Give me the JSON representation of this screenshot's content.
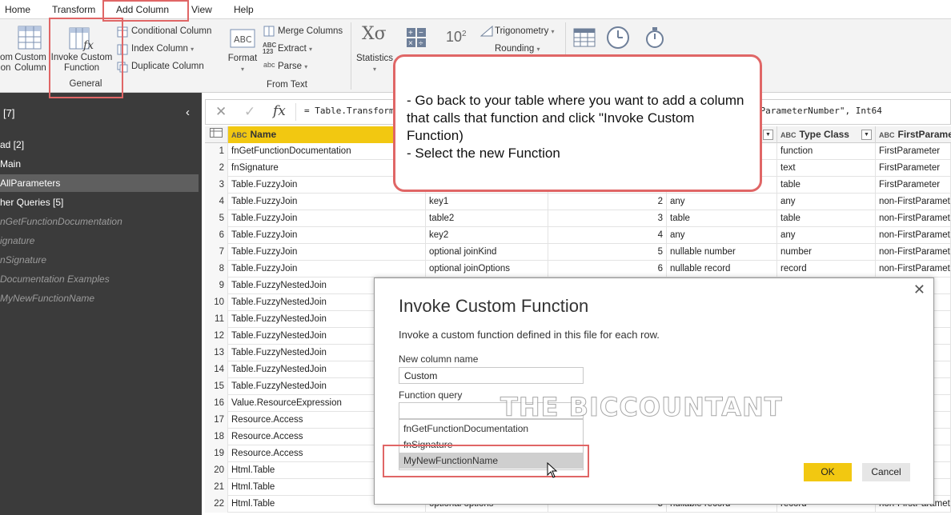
{
  "menu": {
    "items": [
      "Home",
      "Transform",
      "Add Column",
      "View",
      "Help"
    ]
  },
  "ribbon": {
    "custom_column": "Custom\nColumn",
    "custom_column_l1": "Custom",
    "custom_column_l2": "Column",
    "partial_left_l1": "om",
    "partial_left_l2": "on",
    "invoke_l1": "Invoke Custom",
    "invoke_l2": "Function",
    "group_general": "General",
    "conditional_column": "Conditional Column",
    "index_column": "Index Column",
    "duplicate_column": "Duplicate Column",
    "format": "Format",
    "merge_columns": "Merge Columns",
    "extract": "Extract",
    "parse": "Parse",
    "group_from_text": "From Text",
    "statistics": "Statistics",
    "trigonometry": "Trigonometry",
    "rounding": "Rounding",
    "ten_power": "10",
    "abc123": "ABC\n123"
  },
  "sidebar": {
    "header": "[7]",
    "items": [
      {
        "label": "ad [2]",
        "style": "normal"
      },
      {
        "label": "Main",
        "style": "normal"
      },
      {
        "label": "AllParameters",
        "style": "selected"
      },
      {
        "label": "her Queries [5]",
        "style": "normal"
      },
      {
        "label": "nGetFunctionDocumentation",
        "style": "italic"
      },
      {
        "label": "ignature",
        "style": "italic"
      },
      {
        "label": "nSignature",
        "style": "italic"
      },
      {
        "label": "Documentation Examples",
        "style": "italic"
      },
      {
        "label": "MyNewFunctionName",
        "style": "italic"
      }
    ]
  },
  "formula_bar": {
    "cancel_glyph": "✕",
    "commit_glyph": "✓",
    "fx": "fx",
    "formula": "= Table.TransformColumnTypes(Source,{{\"Name\", type text}, {\"Parameter\", type text}, {\"ParameterNumber\", Int64"
  },
  "grid": {
    "headers": [
      {
        "type": "ABC",
        "label": "Name"
      },
      {
        "type": "",
        "label": ""
      },
      {
        "type": "",
        "label": ""
      },
      {
        "type": "",
        "label": ""
      },
      {
        "type": "ABC",
        "label": "Type Class"
      },
      {
        "type": "ABC",
        "label": "FirstParameter"
      }
    ],
    "rows": [
      [
        "1",
        "fnGetFunctionDocumentation",
        "",
        "",
        "",
        "function",
        "FirstParameter"
      ],
      [
        "2",
        "fnSignature",
        "",
        "",
        "",
        "text",
        "FirstParameter"
      ],
      [
        "3",
        "Table.FuzzyJoin",
        "",
        "",
        "",
        "table",
        "FirstParameter"
      ],
      [
        "4",
        "Table.FuzzyJoin",
        "key1",
        "2",
        "any",
        "any",
        "non-FirstParamete"
      ],
      [
        "5",
        "Table.FuzzyJoin",
        "table2",
        "3",
        "table",
        "table",
        "non-FirstParamete"
      ],
      [
        "6",
        "Table.FuzzyJoin",
        "key2",
        "4",
        "any",
        "any",
        "non-FirstParamete"
      ],
      [
        "7",
        "Table.FuzzyJoin",
        "optional joinKind",
        "5",
        "nullable number",
        "number",
        "non-FirstParamete"
      ],
      [
        "8",
        "Table.FuzzyJoin",
        "optional joinOptions",
        "6",
        "nullable record",
        "record",
        "non-FirstParamete"
      ],
      [
        "9",
        "Table.FuzzyNestedJoin",
        "",
        "",
        "",
        "",
        ""
      ],
      [
        "10",
        "Table.FuzzyNestedJoin",
        "",
        "",
        "",
        "",
        ""
      ],
      [
        "11",
        "Table.FuzzyNestedJoin",
        "",
        "",
        "",
        "",
        ""
      ],
      [
        "12",
        "Table.FuzzyNestedJoin",
        "",
        "",
        "",
        "",
        ""
      ],
      [
        "13",
        "Table.FuzzyNestedJoin",
        "",
        "",
        "",
        "",
        ""
      ],
      [
        "14",
        "Table.FuzzyNestedJoin",
        "",
        "",
        "",
        "",
        ""
      ],
      [
        "15",
        "Table.FuzzyNestedJoin",
        "",
        "",
        "",
        "",
        ""
      ],
      [
        "16",
        "Value.ResourceExpression",
        "",
        "",
        "",
        "",
        ""
      ],
      [
        "17",
        "Resource.Access",
        "",
        "",
        "",
        "",
        ""
      ],
      [
        "18",
        "Resource.Access",
        "",
        "",
        "",
        "",
        ""
      ],
      [
        "19",
        "Resource.Access",
        "",
        "",
        "",
        "",
        ""
      ],
      [
        "20",
        "Html.Table",
        "",
        "",
        "",
        "",
        ""
      ],
      [
        "21",
        "Html.Table",
        "",
        "",
        "",
        "",
        ""
      ],
      [
        "22",
        "Html.Table",
        "optional options",
        "5",
        "nullable record",
        "record",
        "non-FirstParamete"
      ]
    ],
    "right_partial": {
      "r9": "r",
      "r10": "ete",
      "r11": "ete",
      "r12": "ete",
      "r13": "ete",
      "r14": "ete",
      "r15": "ete",
      "r16": "r",
      "r17": "r",
      "r18": "ete",
      "r19": "ete",
      "r20": "r",
      "r21": "ete"
    }
  },
  "dialog": {
    "title": "Invoke Custom Function",
    "close_glyph": "✕",
    "description": "Invoke a custom function defined in this file for each row.",
    "new_column_label": "New column name",
    "new_column_value": "Custom",
    "function_query_label": "Function query",
    "function_query_value": "",
    "options": [
      "fnGetFunctionDocumentation",
      "fnSignature",
      "MyNewFunctionName"
    ],
    "selected_option": "MyNewFunctionName",
    "ok_label": "OK",
    "cancel_label": "Cancel"
  },
  "callout": {
    "text": "- Go back to your table where you want to add a column that calls that function and click \"Invoke Custom Function)\n- Select the new Function"
  },
  "watermark": "THE BICCOUNTANT",
  "colors": {
    "accent_yellow": "#f2c811",
    "highlight_red": "#e06666",
    "sidebar_bg": "#3b3b3b",
    "sidebar_selected": "#5f5f5f"
  }
}
